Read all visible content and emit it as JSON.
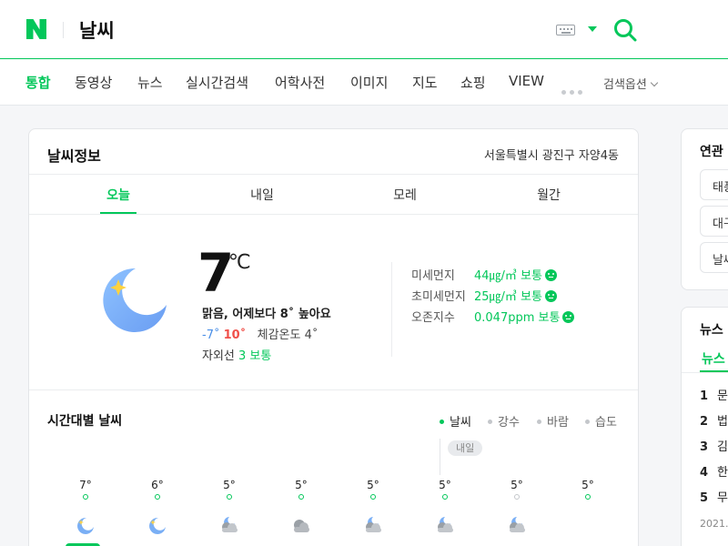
{
  "header": {
    "logo": "N",
    "query": "날씨",
    "keyboard_icon": "keyboard-icon",
    "search_icon": "search-icon"
  },
  "tabs": {
    "items": [
      "통합",
      "동영상",
      "뉴스",
      "실시간검색",
      "어학사전",
      "이미지",
      "지도",
      "쇼핑",
      "VIEW"
    ],
    "active": "통합",
    "more": "more-dots-icon",
    "options": "검색옵션"
  },
  "weather": {
    "title": "날씨정보",
    "location": "서울특별시 광진구 자양4동",
    "day_tabs": [
      "오늘",
      "내일",
      "모레",
      "월간"
    ],
    "active_day": "오늘",
    "current": {
      "temp": "7",
      "unit": "℃",
      "icon": "clear-night-moon-icon",
      "summary": "맑음, 어제보다 8˚ 높아요",
      "min": "-7˚",
      "max": "10˚",
      "feels_label": "체감온도",
      "feels": "4˚",
      "uv_label": "자외선",
      "uv": "3 보통"
    },
    "air": [
      {
        "label": "미세먼지",
        "value": "44㎍/㎥ 보통"
      },
      {
        "label": "초미세먼지",
        "value": "25㎍/㎥ 보통"
      },
      {
        "label": "오존지수",
        "value": "0.047ppm 보통"
      }
    ]
  },
  "hourly": {
    "title": "시간대별 날씨",
    "legend": [
      "날씨",
      "강수",
      "바람",
      "습도"
    ],
    "active_legend": "날씨",
    "next_day_badge": "내일",
    "temps": [
      "7°",
      "6°",
      "5°",
      "5°",
      "5°",
      "5°",
      "5°",
      "5°"
    ],
    "icons": [
      "moon-icon",
      "moon-icon",
      "cloudy-night-icon",
      "cloud-icon",
      "cloudy-night-icon",
      "cloudy-night-icon",
      "cloudy-night-icon",
      ""
    ]
  },
  "related": {
    "title": "연관",
    "chips": [
      "태풍",
      "대구",
      "날씨"
    ]
  },
  "news": {
    "title": "뉴스",
    "tab": "뉴스",
    "items": [
      {
        "rank": "1",
        "text": "문"
      },
      {
        "rank": "2",
        "text": "법"
      },
      {
        "rank": "3",
        "text": "김"
      },
      {
        "rank": "4",
        "text": "한"
      },
      {
        "rank": "5",
        "text": "무"
      }
    ],
    "date": "2021."
  },
  "colors": {
    "brand": "#03c75a",
    "min_temp": "#4a8fe7",
    "max_temp": "#f0504a"
  }
}
